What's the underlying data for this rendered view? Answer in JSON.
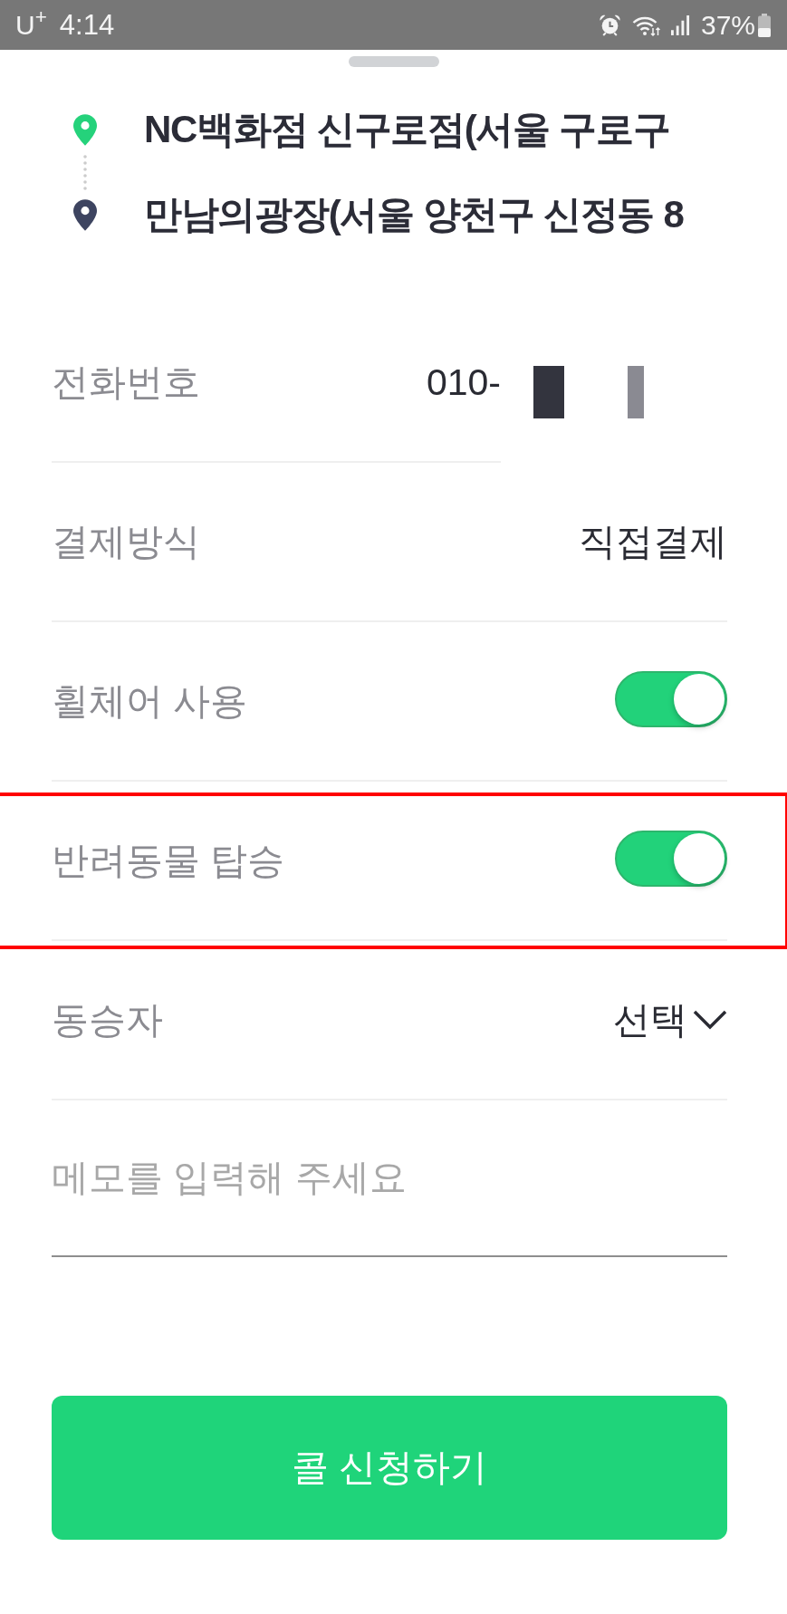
{
  "status_bar": {
    "carrier": "U$^{+}$",
    "time": "4:14",
    "battery": "37%"
  },
  "route": [
    {
      "kind": "origin",
      "text": "NC백화점 신구로점(서울 구로구"
    },
    {
      "kind": "destination",
      "text": "만남의광장(서울 양천구 신정동 8"
    }
  ],
  "form": [
    {
      "kind": "text",
      "label": "전화번호",
      "value": "010-",
      "redacted": true,
      "highlighted": false
    },
    {
      "kind": "text",
      "label": "결제방식",
      "value": "직접결제",
      "redacted": false,
      "highlighted": false
    },
    {
      "kind": "toggle",
      "label": "휠체어 사용",
      "on": true,
      "highlighted": false
    },
    {
      "kind": "toggle",
      "label": "반려동물 탑승",
      "on": true,
      "highlighted": true
    },
    {
      "kind": "select",
      "label": "동승자",
      "value": "선택",
      "highlighted": false
    }
  ],
  "memo": {
    "placeholder": "메모를 입력해 주세요"
  },
  "submit_button": {
    "label": "콜 신청하기"
  }
}
